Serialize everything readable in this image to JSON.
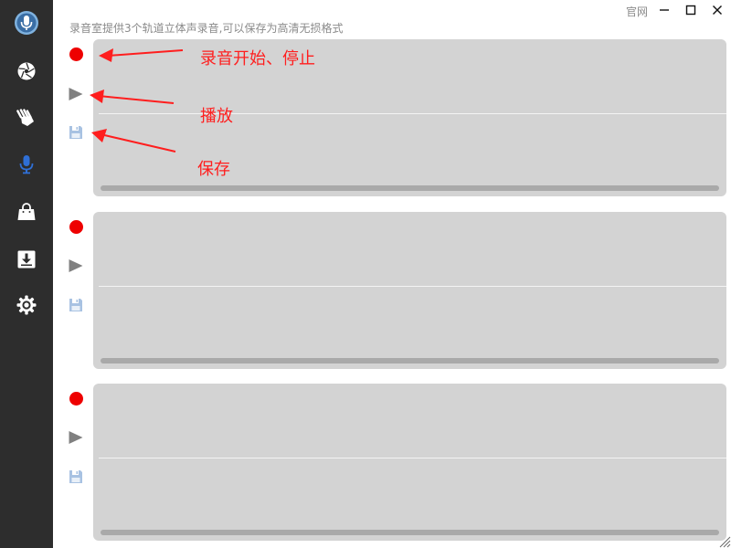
{
  "header": {
    "subtitle": "录音室提供3个轨道立体声录音,可以保存为高清无损格式",
    "official_site_link": "官网"
  },
  "window_controls": [
    "minimize",
    "maximize",
    "close"
  ],
  "sidebar": {
    "items": [
      {
        "icon": "microphone-logo-icon",
        "active": false
      },
      {
        "icon": "aperture-icon",
        "active": false
      },
      {
        "icon": "hands-icon",
        "active": false
      },
      {
        "icon": "microphone-icon",
        "active": true
      },
      {
        "icon": "bag-icon",
        "active": false
      },
      {
        "icon": "download-icon",
        "active": false
      },
      {
        "icon": "gear-icon",
        "active": false
      }
    ]
  },
  "tracks": [
    {
      "controls": [
        "record",
        "play",
        "save"
      ]
    },
    {
      "controls": [
        "record",
        "play",
        "save"
      ]
    },
    {
      "controls": [
        "record",
        "play",
        "save"
      ]
    }
  ],
  "annotations": {
    "record_label": "录音开始、停止",
    "play_label": "播放",
    "save_label": "保存"
  },
  "colors": {
    "sidebar_bg": "#2d2d2d",
    "sidebar_active_icon": "#2f6fd6",
    "record_red": "#ee0000",
    "annotation_red": "#ff1e1e",
    "wave_panel": "#d3d3d3",
    "save_icon": "#a8c2e2"
  }
}
